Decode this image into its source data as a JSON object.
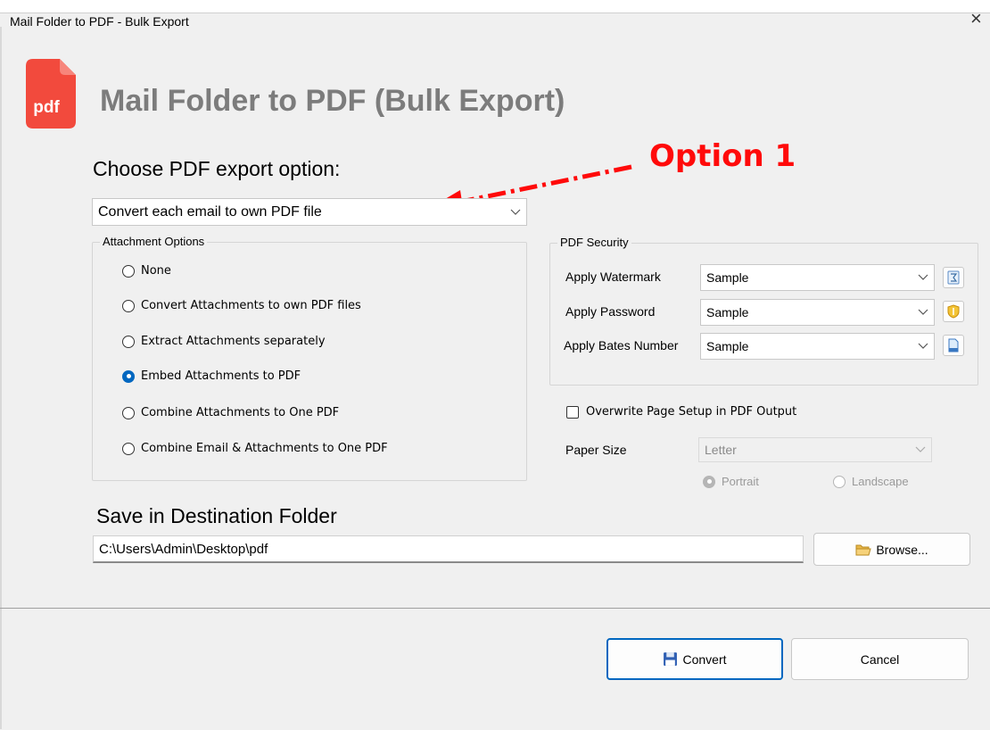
{
  "window": {
    "title": "Mail Folder to PDF - Bulk Export",
    "close_glyph": "×"
  },
  "header": {
    "logo_text": "pdf",
    "title": "Mail Folder to PDF (Bulk Export)"
  },
  "export": {
    "label": "Choose PDF export option:",
    "selected": "Convert each email to own PDF file",
    "annotation": "Option 1"
  },
  "attachment_options": {
    "legend": "Attachment Options",
    "options": [
      {
        "label": "None",
        "checked": false
      },
      {
        "label": "Convert Attachments to own PDF files",
        "checked": false
      },
      {
        "label": "Extract Attachments separately",
        "checked": false
      },
      {
        "label": "Embed Attachments to PDF",
        "checked": true
      },
      {
        "label": "Combine Attachments to One PDF",
        "checked": false
      },
      {
        "label": "Combine Email & Attachments to One PDF",
        "checked": false
      }
    ]
  },
  "pdf_security": {
    "legend": "PDF Security",
    "rows": [
      {
        "label": "Apply Watermark",
        "value": "Sample",
        "icon": "watermark-edit-icon"
      },
      {
        "label": "Apply Password",
        "value": "Sample",
        "icon": "shield-icon"
      },
      {
        "label": "Apply Bates Number",
        "value": "Sample",
        "icon": "document-icon"
      }
    ]
  },
  "page_setup": {
    "overwrite_label": "Overwrite Page Setup in PDF Output",
    "overwrite_checked": false,
    "paper_size_label": "Paper Size",
    "paper_size_value": "Letter",
    "orientation": [
      {
        "label": "Portrait",
        "checked": true
      },
      {
        "label": "Landscape",
        "checked": false
      }
    ]
  },
  "destination": {
    "label": "Save in Destination Folder",
    "path": "C:\\Users\\Admin\\Desktop\\pdf",
    "browse_label": "Browse..."
  },
  "actions": {
    "convert_label": "Convert",
    "cancel_label": "Cancel"
  },
  "colors": {
    "annotation": "#ff0a0a",
    "accent": "#0067c0",
    "pdf_red": "#f24a3d",
    "title_gray": "#7c7c7c"
  }
}
